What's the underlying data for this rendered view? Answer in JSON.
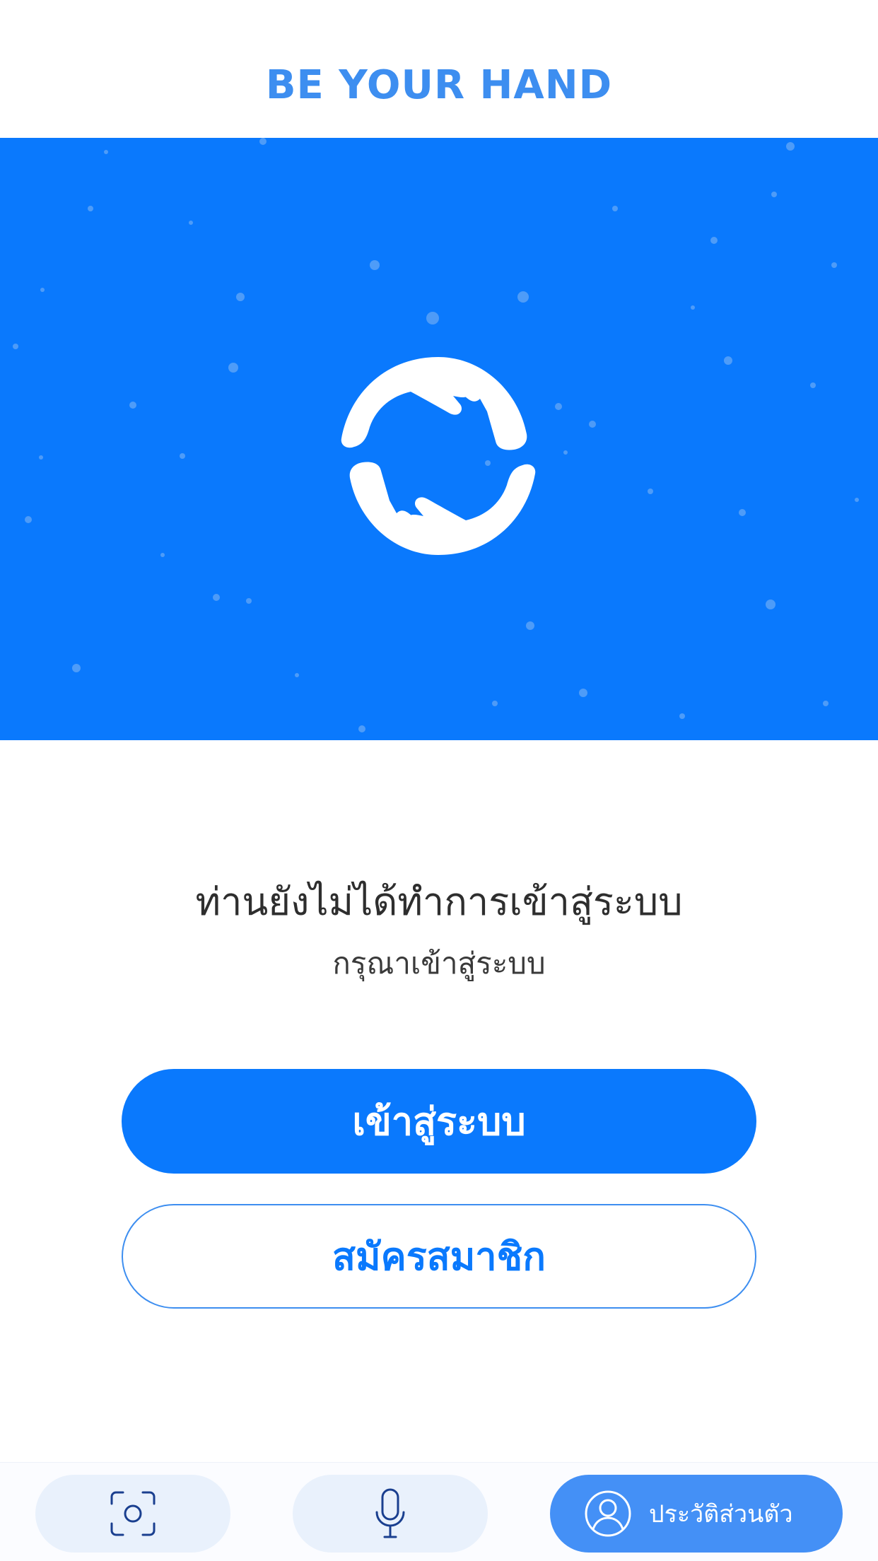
{
  "header": {
    "app_title": "BE YOUR HAND"
  },
  "hero": {
    "background_color": "#0a79fd",
    "logo_icon": "helping-hands-circle-icon"
  },
  "message": {
    "headline": "ท่านยังไม่ได้ทำการเข้าสู่ระบบ",
    "subline": "กรุณาเข้าสู่ระบบ"
  },
  "actions": {
    "login_label": "เข้าสู่ระบบ",
    "register_label": "สมัครสมาชิก"
  },
  "bottom_nav": {
    "items": [
      {
        "icon": "camera-scan-icon",
        "label": ""
      },
      {
        "icon": "microphone-icon",
        "label": ""
      },
      {
        "icon": "user-avatar-icon",
        "label": "ประวัติส่วนตัว",
        "active": true
      }
    ]
  },
  "colors": {
    "accent": "#0a79fd",
    "title": "#3d8ef0",
    "nav_pill": "#e9f1fc",
    "nav_active": "#4490f6"
  }
}
